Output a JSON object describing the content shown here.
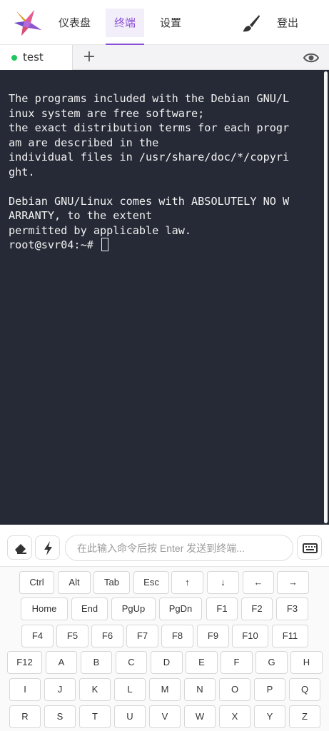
{
  "header": {
    "nav": [
      {
        "label": "仪表盘",
        "active": false
      },
      {
        "label": "终端",
        "active": true
      },
      {
        "label": "设置",
        "active": false
      }
    ],
    "logout_label": "登出",
    "accent_color": "#8a4fd6"
  },
  "tabs": [
    {
      "label": "test",
      "status_color": "#22c55e"
    }
  ],
  "tab_add_label": "+",
  "terminal": {
    "lines": [
      "The programs included with the Debian GNU/L",
      "inux system are free software;",
      "the exact distribution terms for each progr",
      "am are described in the",
      "individual files in /usr/share/doc/*/copyri",
      "ght.",
      "",
      "Debian GNU/Linux comes with ABSOLUTELY NO W",
      "ARRANTY, to the extent",
      "permitted by applicable law."
    ],
    "prompt": "root@svr04:~#",
    "background": "#262a36"
  },
  "input": {
    "placeholder": "在此输入命令后按 Enter 发送到终端...",
    "value": ""
  },
  "keyboard": {
    "rows": [
      [
        "Ctrl",
        "Alt",
        "Tab",
        "Esc",
        "↑",
        "↓",
        "←",
        "→"
      ],
      [
        "Home",
        "End",
        "PgUp",
        "PgDn",
        "F1",
        "F2",
        "F3"
      ],
      [
        "F4",
        "F5",
        "F6",
        "F7",
        "F8",
        "F9",
        "F10",
        "F11"
      ],
      [
        "F12",
        "A",
        "B",
        "C",
        "D",
        "E",
        "F",
        "G",
        "H"
      ],
      [
        "I",
        "J",
        "K",
        "L",
        "M",
        "N",
        "O",
        "P",
        "Q"
      ],
      [
        "R",
        "S",
        "T",
        "U",
        "V",
        "W",
        "X",
        "Y",
        "Z"
      ]
    ]
  }
}
